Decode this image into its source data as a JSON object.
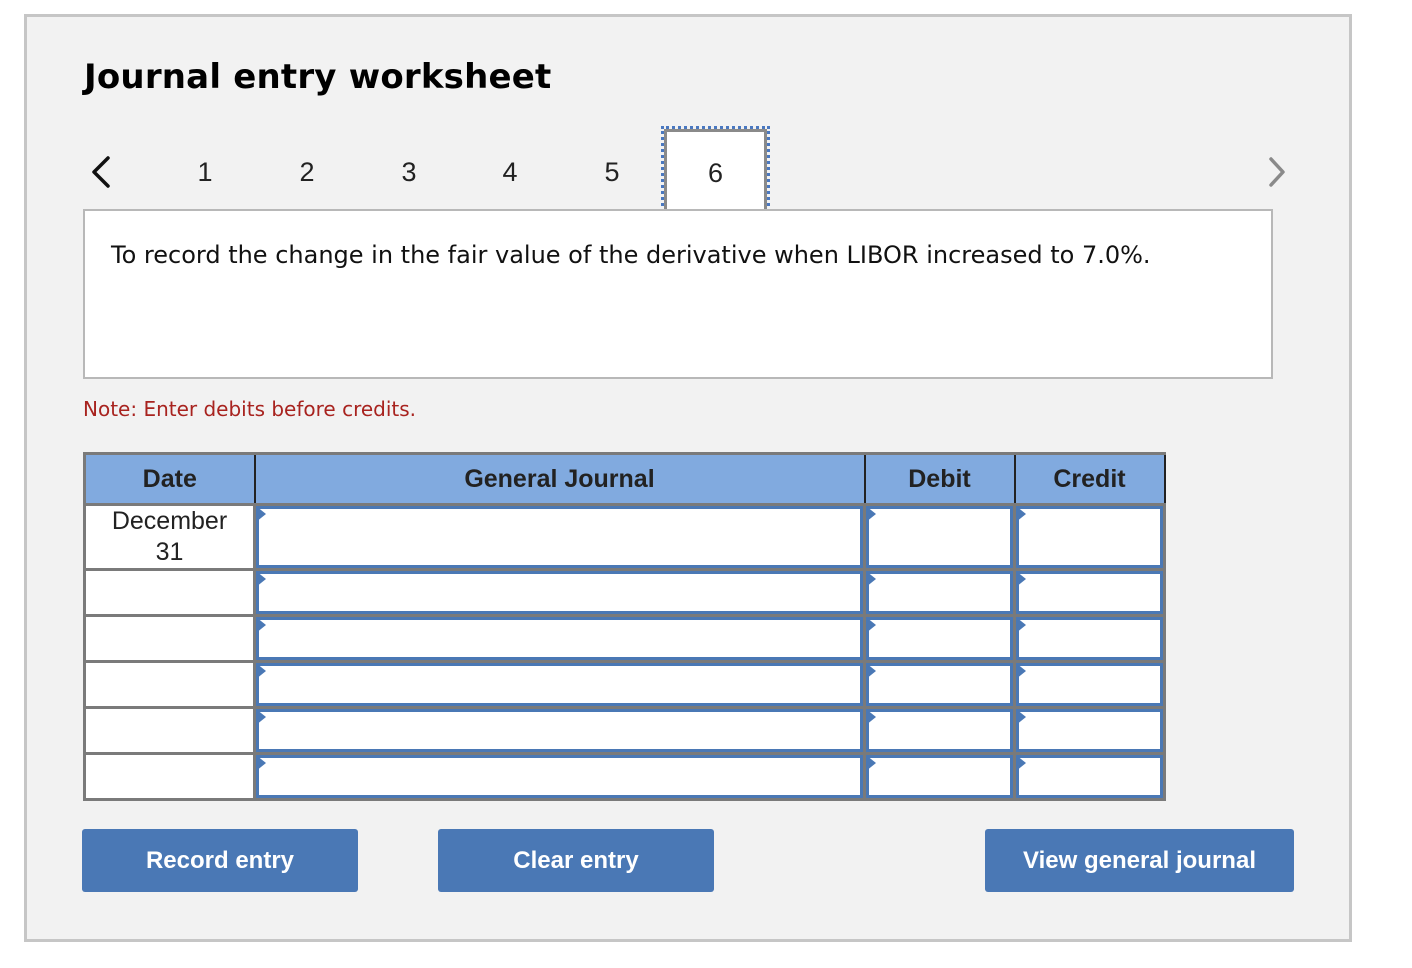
{
  "header": {
    "title": "Journal entry worksheet"
  },
  "pager": {
    "prev_icon": "chevron-left-icon",
    "next_icon": "chevron-right-icon",
    "tabs": [
      {
        "label": "1",
        "active": false
      },
      {
        "label": "2",
        "active": false
      },
      {
        "label": "3",
        "active": false
      },
      {
        "label": "4",
        "active": false
      },
      {
        "label": "5",
        "active": false
      },
      {
        "label": "6",
        "active": true
      }
    ]
  },
  "description": "To record the change in the fair value of the derivative when LIBOR increased to 7.0%.",
  "note": "Note: Enter debits before credits.",
  "journal": {
    "columns": [
      "Date",
      "General Journal",
      "Debit",
      "Credit"
    ],
    "rows": [
      {
        "date": "December 31",
        "account": "",
        "debit": "",
        "credit": ""
      },
      {
        "date": "",
        "account": "",
        "debit": "",
        "credit": ""
      },
      {
        "date": "",
        "account": "",
        "debit": "",
        "credit": ""
      },
      {
        "date": "",
        "account": "",
        "debit": "",
        "credit": ""
      },
      {
        "date": "",
        "account": "",
        "debit": "",
        "credit": ""
      },
      {
        "date": "",
        "account": "",
        "debit": "",
        "credit": ""
      }
    ]
  },
  "buttons": {
    "record": "Record entry",
    "clear": "Clear entry",
    "view": "View general journal"
  },
  "colors": {
    "accent": "#4a78b5",
    "header_bg": "#81aadf",
    "note": "#a8231f",
    "panel_bg": "#f2f2f2"
  }
}
